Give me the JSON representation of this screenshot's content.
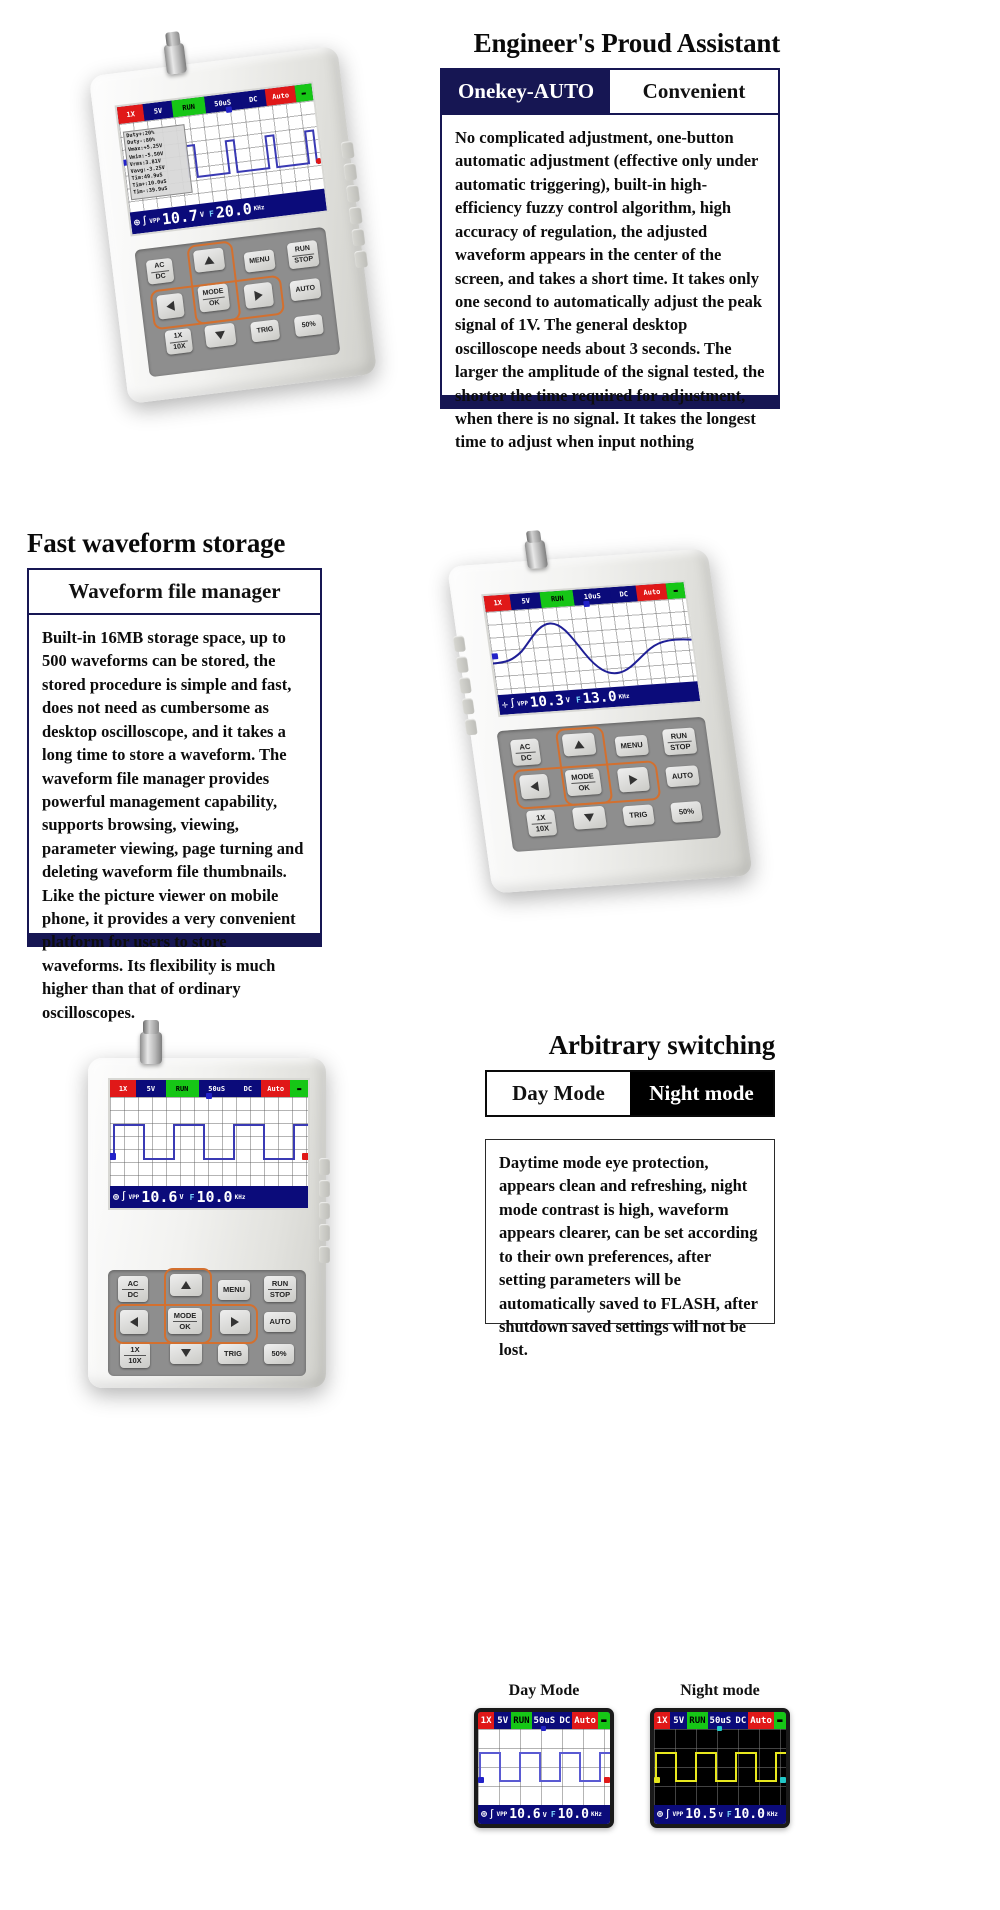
{
  "sections": {
    "auto": {
      "title": "Engineer's Proud Assistant",
      "tab_left": "Onekey-AUTO",
      "tab_right": "Convenient",
      "body": "No complicated adjustment, one-button automatic adjustment (effective only under automatic triggering), built-in high-efficiency fuzzy control algorithm, high accuracy of regulation, the adjusted waveform appears in the center of the screen, and takes a short time. It takes only one second to automatically adjust the peak signal of 1V. The general desktop oscilloscope needs about 3 seconds. The larger the amplitude of the signal tested, the shorter the time required for adjustment, when there is no signal. It takes the longest time to adjust when input nothing"
    },
    "storage": {
      "title": "Fast waveform storage",
      "tab_label": "Waveform file manager",
      "body": "Built-in 16MB storage space, up to 500 waveforms can be stored, the stored procedure is simple and fast, does not need as cumbersome as desktop oscilloscope, and it takes a long time to store a waveform. The waveform file manager provides powerful management capability, supports browsing, viewing, parameter viewing, page turning and deleting waveform file thumbnails. Like the picture viewer on mobile phone, it provides a very convenient platform for users to store waveforms. Its flexibility is much higher than that of ordinary oscilloscopes."
    },
    "switching": {
      "title": "Arbitrary switching",
      "tab_left": "Day Mode",
      "tab_right": "Night mode",
      "body": "Daytime mode eye protection, appears clean and refreshing, night mode contrast is high, waveform appears clearer, can be set according to their own preferences, after setting parameters will be automatically saved to FLASH, after shutdown saved settings will not be lost."
    }
  },
  "device_1": {
    "status_bar": {
      "probe": "1X",
      "volts": "5V",
      "run": "RUN",
      "timebase": "50uS",
      "coupling": "DC",
      "trigger": "Auto",
      "battery": "batt"
    },
    "measurements": [
      "Duty+:20%",
      "Duty-:80%",
      "Vmax:+5.25V",
      "Vmin:-5.50V",
      "Vrms:3.81V",
      "Vavg:-3.25V",
      "Tim:49.9uS",
      "Tim+:10.0uS",
      "Tim-:39.9uS"
    ],
    "readout": {
      "vpp_label": "VPP",
      "vpp_value": "10.7",
      "vpp_unit": "V",
      "freq_label": "F",
      "freq_value": "20.0",
      "freq_unit": "KHz"
    },
    "keys": {
      "acdc_1": "AC",
      "acdc_2": "DC",
      "mode_1": "MODE",
      "mode_2": "OK",
      "menu": "MENU",
      "run_1": "RUN",
      "run_2": "STOP",
      "x_1": "1X",
      "x_2": "10X",
      "trig": "TRIG",
      "auto": "AUTO",
      "fifty": "50%"
    }
  },
  "device_2": {
    "status_bar": {
      "probe": "1X",
      "volts": "5V",
      "run": "RUN",
      "timebase": "10uS",
      "coupling": "DC",
      "trigger": "Auto",
      "battery": "batt"
    },
    "readout": {
      "vpp_label": "VPP",
      "vpp_value": "10.3",
      "vpp_unit": "V",
      "freq_label": "F",
      "freq_value": "13.0",
      "freq_unit": "KHz"
    },
    "keys": {
      "acdc_1": "AC",
      "acdc_2": "DC",
      "mode_1": "MODE",
      "mode_2": "OK",
      "menu": "MENU",
      "run_1": "RUN",
      "run_2": "STOP",
      "x_1": "1X",
      "x_2": "10X",
      "trig": "TRIG",
      "auto": "AUTO",
      "fifty": "50%"
    }
  },
  "device_3": {
    "status_bar": {
      "probe": "1X",
      "volts": "5V",
      "run": "RUN",
      "timebase": "50uS",
      "coupling": "DC",
      "trigger": "Auto",
      "battery": "batt"
    },
    "readout": {
      "vpp_label": "VPP",
      "vpp_value": "10.6",
      "vpp_unit": "V",
      "freq_label": "F",
      "freq_value": "10.0",
      "freq_unit": "KHz"
    },
    "keys": {
      "acdc_1": "AC",
      "acdc_2": "DC",
      "mode_1": "MODE",
      "mode_2": "OK",
      "menu": "MENU",
      "run_1": "RUN",
      "run_2": "STOP",
      "x_1": "1X",
      "x_2": "10X",
      "trig": "TRIG",
      "auto": "AUTO",
      "fifty": "50%"
    }
  },
  "thumbnails": {
    "day": {
      "label": "Day Mode",
      "status_bar": {
        "probe": "1X",
        "volts": "5V",
        "run": "RUN",
        "timebase": "50uS",
        "coupling": "DC",
        "trigger": "Auto",
        "battery": "batt"
      },
      "readout": {
        "vpp_label": "VPP",
        "vpp_value": "10.6",
        "vpp_unit": "V",
        "freq_label": "F",
        "freq_value": "10.0",
        "freq_unit": "KHz"
      }
    },
    "night": {
      "label": "Night mode",
      "status_bar": {
        "probe": "1X",
        "volts": "5V",
        "run": "RUN",
        "timebase": "50uS",
        "coupling": "DC",
        "trigger": "Auto",
        "battery": "batt"
      },
      "readout": {
        "vpp_label": "VPP",
        "vpp_value": "10.5",
        "vpp_unit": "V",
        "freq_label": "F",
        "freq_value": "10.0",
        "freq_unit": "KHz"
      }
    }
  },
  "colors": {
    "navy": "#161653",
    "screen_navy": "#0b0b7a",
    "red": "#e01818",
    "green": "#16c616",
    "trace_blue": "#3a3ab4",
    "trace_yellow": "#e8e81e",
    "accent_orange": "#d3702f"
  }
}
